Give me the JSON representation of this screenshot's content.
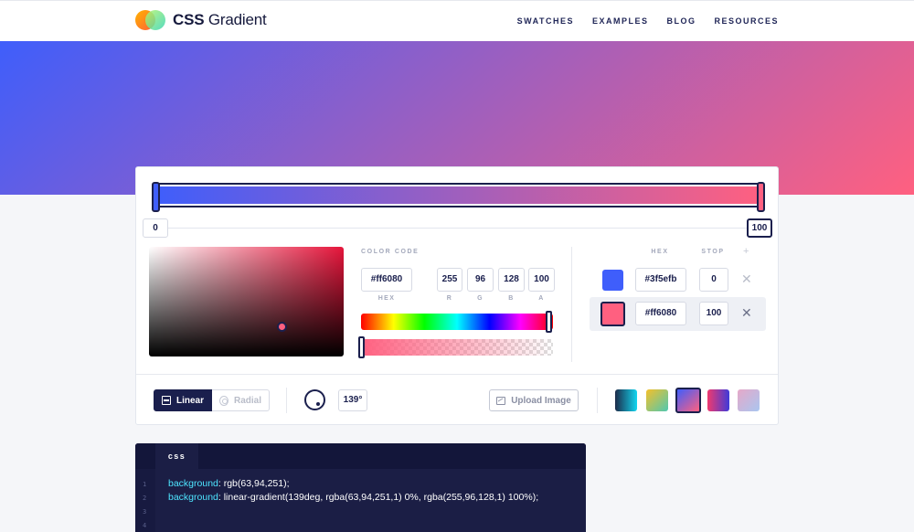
{
  "brand": {
    "name_bold": "CSS",
    "name_light": "Gradient"
  },
  "nav": {
    "items": [
      "SWATCHES",
      "EXAMPLES",
      "BLOG",
      "RESOURCES"
    ]
  },
  "gradient": {
    "type": "linear",
    "angle_deg": 139,
    "stops": [
      {
        "hex": "#3f5efb",
        "position": "0"
      },
      {
        "hex": "#ff6080",
        "position": "100"
      }
    ]
  },
  "positions": {
    "start": "0",
    "end": "100"
  },
  "picker": {
    "label": "COLOR CODE",
    "hex": "#ff6080",
    "r": "255",
    "g": "96",
    "b": "128",
    "a": "100",
    "labels": {
      "hex": "HEX",
      "r": "R",
      "g": "G",
      "b": "B",
      "a": "A"
    }
  },
  "stops_panel": {
    "header_hex": "HEX",
    "header_stop": "STOP",
    "header_add": "+",
    "remove_glyph": "✕",
    "rows": [
      {
        "hex": "#3f5efb",
        "stop": "0"
      },
      {
        "hex": "#ff6080",
        "stop": "100"
      }
    ]
  },
  "controls": {
    "linear_label": "Linear",
    "radial_label": "Radial",
    "angle_label": "139°",
    "upload_label": "Upload Image"
  },
  "presets": [
    {
      "from": "#1c2b4a",
      "to": "#12d6f0"
    },
    {
      "from": "#f5c02a",
      "to": "#4fc8b0"
    },
    {
      "from": "#3f5efb",
      "to": "#ff6080"
    },
    {
      "from": "#f03a6e",
      "to": "#3f3ad9"
    },
    {
      "from": "#e6a8c8",
      "to": "#a9c6f0"
    }
  ],
  "colors": {
    "navy": "#1a1f4d",
    "accent_start": "#3f5efb",
    "accent_end": "#ff6080",
    "code_prop": "#4ee5ff"
  },
  "code": {
    "tab": "css",
    "line_numbers": [
      "1",
      "2",
      "3",
      "4"
    ],
    "lines": [
      {
        "prop": "background",
        "value": ": rgb(63,94,251);"
      },
      {
        "prop": "background",
        "value": ": linear-gradient(139deg, rgba(63,94,251,1) 0%, rgba(255,96,128,1) 100%);"
      }
    ]
  }
}
